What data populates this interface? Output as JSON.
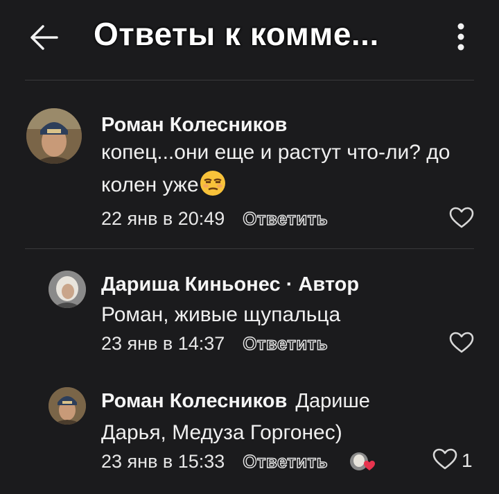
{
  "header": {
    "title": "Ответы к комме...",
    "back_icon": "arrow-left-icon",
    "menu_icon": "more-vertical-icon"
  },
  "comments": [
    {
      "author": "Роман Колесников",
      "text": "копец...они еще и растут что-ли? до колен уже",
      "emoji": "unamused-face",
      "date": "22 янв в 20:49",
      "reply_label": "Ответить",
      "likes": ""
    },
    {
      "author": "Дариша Киньонес · Автор",
      "text": "Роман, живые щупальца",
      "date": "23 янв в 14:37",
      "reply_label": "Ответить",
      "likes": ""
    },
    {
      "author": "Роман Колесников",
      "reply_to": "Дарише",
      "text": "Дарья, Медуза Горгонес)",
      "date": "23 янв в 15:33",
      "reply_label": "Ответить",
      "likes": "1"
    }
  ],
  "colors": {
    "background": "#1b1b1d",
    "text": "#f2f2f2",
    "divider": "#3a3a3c",
    "heart_red": "#e8344e"
  }
}
